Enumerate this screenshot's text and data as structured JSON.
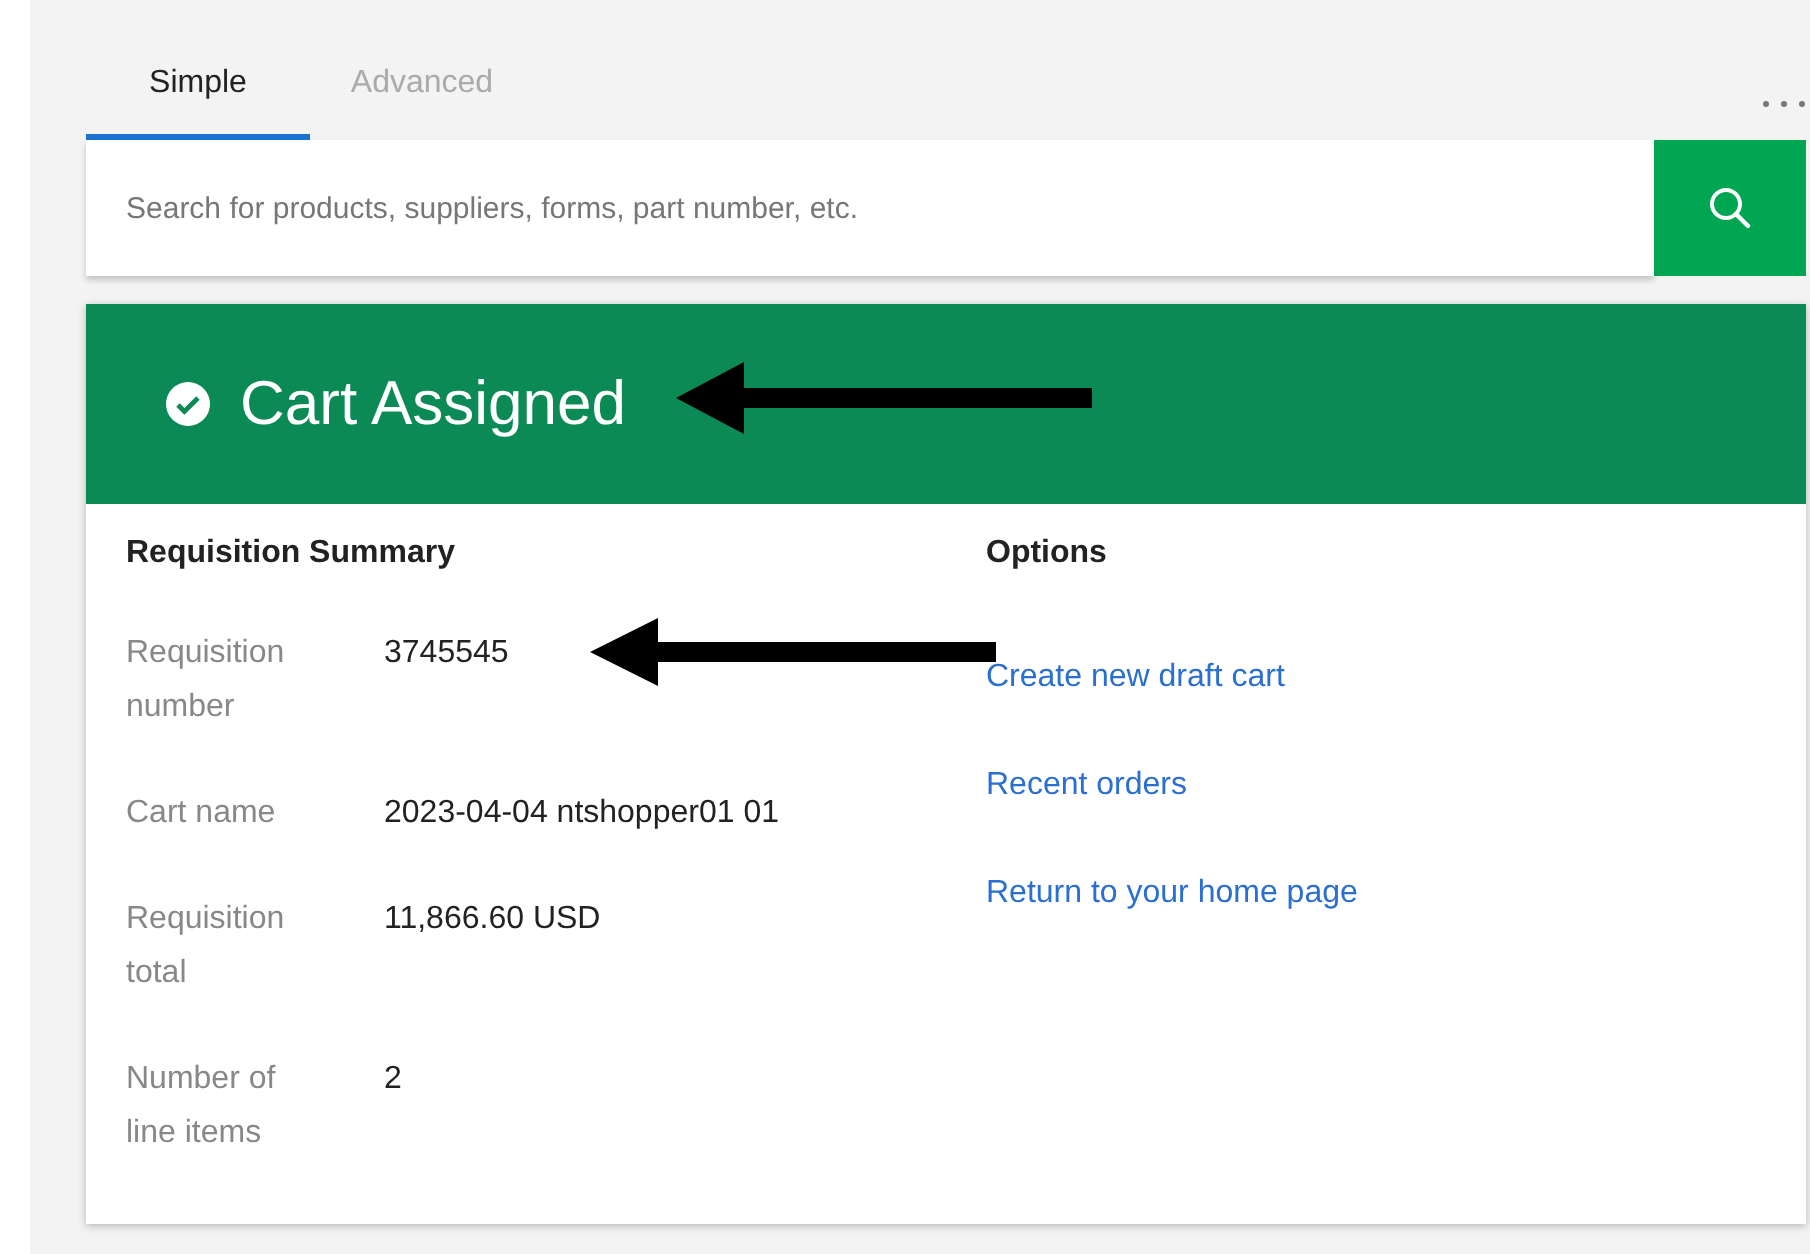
{
  "tabs": [
    {
      "label": "Simple",
      "selected": true
    },
    {
      "label": "Advanced",
      "selected": false
    }
  ],
  "search": {
    "placeholder": "Search for products, suppliers, forms, part number, etc."
  },
  "banner": {
    "title": "Cart Assigned"
  },
  "summary": {
    "heading": "Requisition Summary",
    "fields": [
      {
        "label": "Requisition number",
        "value": "3745545"
      },
      {
        "label": "Cart name",
        "value": "2023-04-04 ntshopper01 01"
      },
      {
        "label": "Requisition total",
        "value": "11,866.60 USD"
      },
      {
        "label": "Number of line items",
        "value": "2"
      }
    ]
  },
  "options": {
    "heading": "Options",
    "links": [
      "Create new draft cart",
      "Recent orders",
      "Return to your home page"
    ]
  }
}
